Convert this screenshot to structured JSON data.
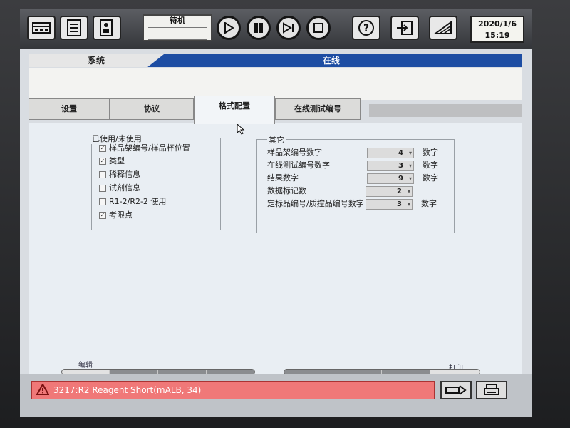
{
  "toolbar": {
    "status_text": "待机",
    "date": "2020/1/6",
    "time": "15:19"
  },
  "header": {
    "system_label": "系统",
    "online_label": "在线"
  },
  "tabs": [
    {
      "label": "设置",
      "active": false
    },
    {
      "label": "协议",
      "active": false
    },
    {
      "label": "格式配置",
      "active": true
    },
    {
      "label": "在线测试编号",
      "active": false
    }
  ],
  "used_group": {
    "title": "已使用/未使用",
    "items": [
      {
        "label": "样品架编号/样品杯位置",
        "checked": true
      },
      {
        "label": "类型",
        "checked": true
      },
      {
        "label": "稀释信息",
        "checked": false
      },
      {
        "label": "试剂信息",
        "checked": false
      },
      {
        "label": "R1-2/R2-2 使用",
        "checked": false
      },
      {
        "label": "考限点",
        "checked": true
      }
    ]
  },
  "other_group": {
    "title": "其它",
    "fields": [
      {
        "label": "样品架编号数字",
        "value": "4",
        "unit": "数字"
      },
      {
        "label": "在线测试编号数字",
        "value": "3",
        "unit": "数字"
      },
      {
        "label": "结果数字",
        "value": "9",
        "unit": "数字"
      },
      {
        "label": "数据标记数",
        "value": "2",
        "unit": ""
      },
      {
        "label": "定标品编号/质控品编号数字",
        "value": "3",
        "unit": "数字"
      }
    ]
  },
  "footer": {
    "left_label": "编辑",
    "right_label": "打印"
  },
  "error": {
    "message": "3217:R2 Reagent Short(mALB, 34)"
  }
}
